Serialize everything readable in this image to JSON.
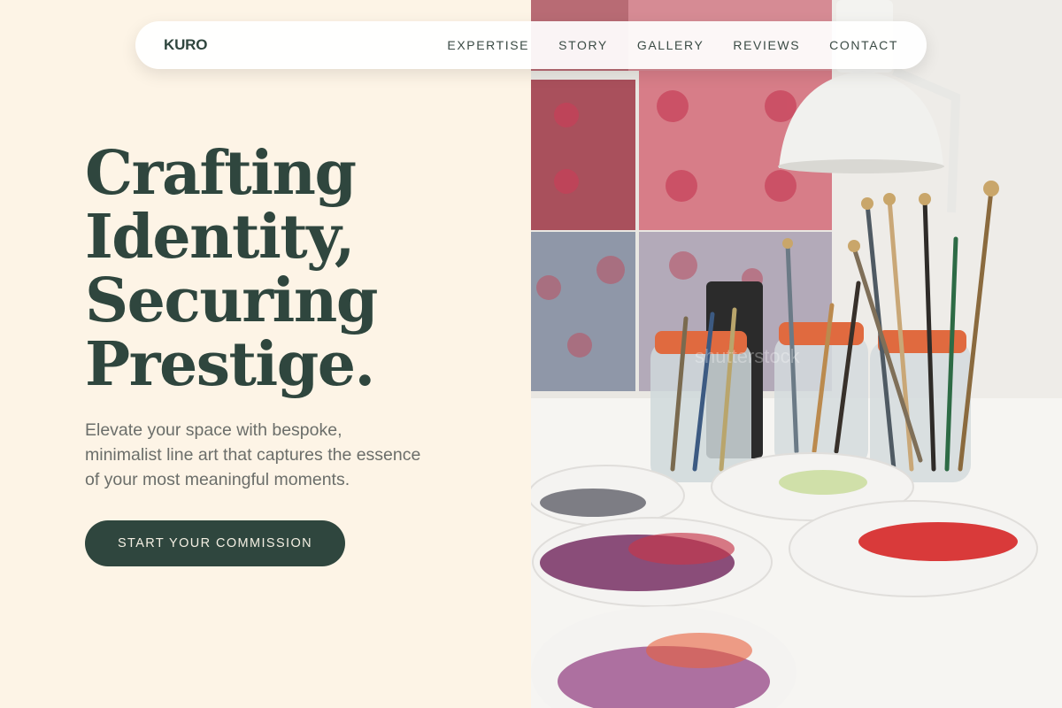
{
  "nav": {
    "logo": "KURO",
    "links": [
      "EXPERTISE",
      "STORY",
      "GALLERY",
      "REVIEWS",
      "CONTACT"
    ]
  },
  "hero": {
    "title_lines": [
      "Crafting",
      "Identity,",
      "Securing",
      "Prestige."
    ],
    "subtitle_lines": [
      "Elevate your space with bespoke,",
      "minimalist line art that captures the essence",
      "of your most meaningful moments."
    ],
    "cta_label": "START YOUR COMMISSION"
  },
  "image": {
    "watermark": "shutterstock"
  },
  "colors": {
    "background": "#fdf4e6",
    "primary": "#2f463e",
    "body_text": "#6b6e6a"
  }
}
